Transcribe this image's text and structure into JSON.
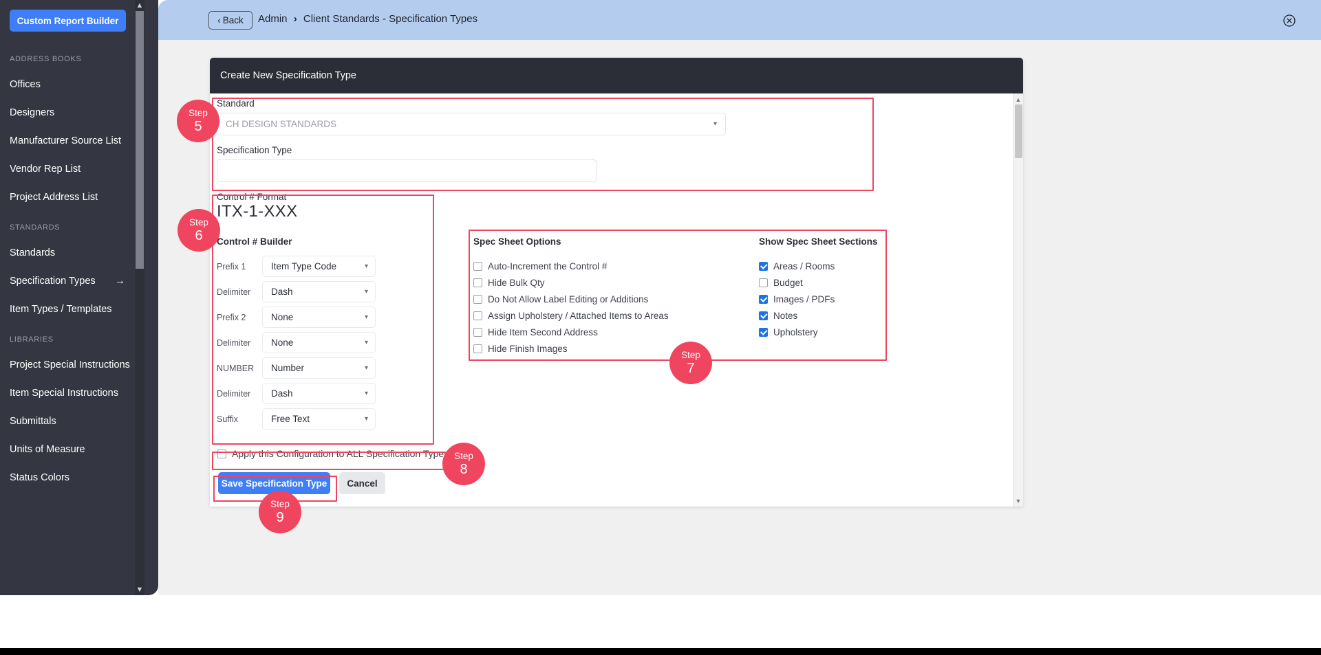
{
  "sidebar": {
    "report_button": "Custom Report Builder",
    "groups": [
      {
        "label": "ADDRESS BOOKS",
        "items": [
          {
            "label": "Offices",
            "arrow": ""
          },
          {
            "label": "Designers",
            "arrow": ""
          },
          {
            "label": "Manufacturer Source List",
            "arrow": ""
          },
          {
            "label": "Vendor Rep List",
            "arrow": ""
          },
          {
            "label": "Project Address List",
            "arrow": ""
          }
        ]
      },
      {
        "label": "STANDARDS",
        "items": [
          {
            "label": "Standards",
            "arrow": ""
          },
          {
            "label": "Specification Types",
            "arrow": "→"
          },
          {
            "label": "Item Types / Templates",
            "arrow": ""
          }
        ]
      },
      {
        "label": "LIBRARIES",
        "items": [
          {
            "label": "Project Special Instructions",
            "arrow": ""
          },
          {
            "label": "Item Special Instructions",
            "arrow": ""
          },
          {
            "label": "Submittals",
            "arrow": ""
          },
          {
            "label": "Units of Measure",
            "arrow": ""
          },
          {
            "label": "Status Colors",
            "arrow": ""
          }
        ]
      }
    ]
  },
  "topbar": {
    "back_label": "Back",
    "back_chevron": "‹",
    "breadcrumb_root": "Admin",
    "breadcrumb_sep": "›",
    "breadcrumb_current": "Client Standards - Specification Types",
    "close_icon": "close-icon"
  },
  "card": {
    "title": "Create New Specification Type",
    "standard_label": "Standard",
    "standard_value": "CH DESIGN STANDARDS",
    "spec_type_label": "Specification Type",
    "spec_type_value": "",
    "control_format_label": "Control # Format",
    "control_format_value": "ITX-1-XXX",
    "control_builder_title": "Control # Builder",
    "builder_rows": [
      {
        "label": "Prefix 1",
        "value": "Item Type Code"
      },
      {
        "label": "Delimiter",
        "value": "Dash"
      },
      {
        "label": "Prefix 2",
        "value": "None"
      },
      {
        "label": "Delimiter",
        "value": "None"
      },
      {
        "label": "NUMBER",
        "value": "Number"
      },
      {
        "label": "Delimiter",
        "value": "Dash"
      },
      {
        "label": "Suffix",
        "value": "Free Text"
      }
    ],
    "spec_sheet_options_title": "Spec Sheet Options",
    "spec_sheet_options": [
      {
        "label": "Auto-Increment the Control #",
        "checked": false
      },
      {
        "label": "Hide Bulk Qty",
        "checked": false
      },
      {
        "label": "Do Not Allow Label Editing or Additions",
        "checked": false
      },
      {
        "label": "Assign Upholstery / Attached Items to Areas",
        "checked": false
      },
      {
        "label": "Hide Item Second Address",
        "checked": false
      },
      {
        "label": "Hide Finish Images",
        "checked": false
      }
    ],
    "show_sections_title": "Show Spec Sheet Sections",
    "show_sections": [
      {
        "label": "Areas / Rooms",
        "checked": true
      },
      {
        "label": "Budget",
        "checked": false
      },
      {
        "label": "Images / PDFs",
        "checked": true
      },
      {
        "label": "Notes",
        "checked": true
      },
      {
        "label": "Upholstery",
        "checked": true
      }
    ],
    "apply_all_label": "Apply this Configuration to ALL Specification Types",
    "apply_all_checked": false,
    "save_label": "Save Specification Type",
    "cancel_label": "Cancel"
  },
  "annotations": {
    "step_word": "Step",
    "steps": [
      {
        "num": "5"
      },
      {
        "num": "6"
      },
      {
        "num": "7"
      },
      {
        "num": "8"
      },
      {
        "num": "9"
      }
    ]
  },
  "colors": {
    "accent_blue": "#3f7ef7",
    "annotation_red": "#f0455f",
    "sidebar_bg": "#343741",
    "topbar_bg": "#b4cdee",
    "card_header_bg": "#2b2e36",
    "checkbox_blue": "#1a73e8"
  }
}
